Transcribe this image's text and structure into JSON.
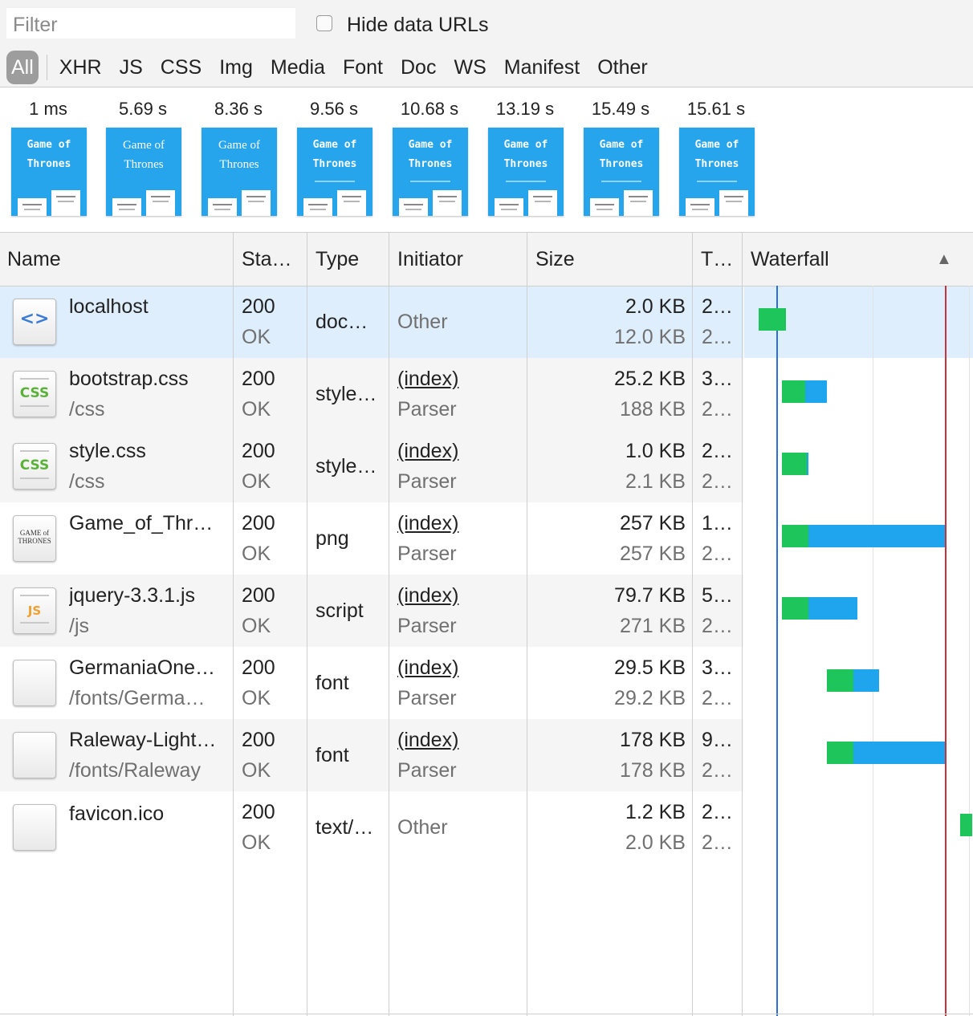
{
  "toolbar": {
    "filter_placeholder": "Filter",
    "hide_data_urls_label": "Hide data URLs",
    "hide_data_urls_checked": false,
    "type_filters": [
      "All",
      "XHR",
      "JS",
      "CSS",
      "Img",
      "Media",
      "Font",
      "Doc",
      "WS",
      "Manifest",
      "Other"
    ],
    "active_filter": "All"
  },
  "filmstrip": {
    "frames": [
      {
        "time": "1 ms",
        "thumb_title": "Game of Thrones"
      },
      {
        "time": "5.69 s",
        "thumb_title": "Game of Thrones"
      },
      {
        "time": "8.36 s",
        "thumb_title": "Game of Thrones"
      },
      {
        "time": "9.56 s",
        "thumb_title": "Game of Thrones"
      },
      {
        "time": "10.68 s",
        "thumb_title": "Game of Thrones"
      },
      {
        "time": "13.19 s",
        "thumb_title": "Game of Thrones"
      },
      {
        "time": "15.49 s",
        "thumb_title": "Game of Thrones"
      },
      {
        "time": "15.61 s",
        "thumb_title": "Game of Thrones"
      }
    ]
  },
  "table": {
    "columns": {
      "name": "Name",
      "status": "Sta…",
      "type": "Type",
      "initiator": "Initiator",
      "size": "Size",
      "time": "T…",
      "waterfall": "Waterfall"
    },
    "sort_indicator": "▲",
    "rows": [
      {
        "name": "localhost",
        "path": "",
        "icon": "html-file-icon",
        "status_code": "200",
        "status_text": "OK",
        "type": "doc…",
        "initiator": "Other",
        "initiator_detail": "",
        "size": "2.0 KB",
        "resource_size": "12.0 KB",
        "time": "2…",
        "latency": "2…"
      },
      {
        "name": "bootstrap.css",
        "path": "/css",
        "icon": "css-file-icon",
        "status_code": "200",
        "status_text": "OK",
        "type": "style…",
        "initiator": "(index)",
        "initiator_detail": "Parser",
        "size": "25.2 KB",
        "resource_size": "188 KB",
        "time": "3…",
        "latency": "2…"
      },
      {
        "name": "style.css",
        "path": "/css",
        "icon": "css-file-icon",
        "status_code": "200",
        "status_text": "OK",
        "type": "style…",
        "initiator": "(index)",
        "initiator_detail": "Parser",
        "size": "1.0 KB",
        "resource_size": "2.1 KB",
        "time": "2…",
        "latency": "2…"
      },
      {
        "name": "Game_of_Thr…",
        "path": "",
        "icon": "image-thumbnail-icon",
        "status_code": "200",
        "status_text": "OK",
        "type": "png",
        "initiator": "(index)",
        "initiator_detail": "Parser",
        "size": "257 KB",
        "resource_size": "257 KB",
        "time": "1…",
        "latency": "2…"
      },
      {
        "name": "jquery-3.3.1.js",
        "path": "/js",
        "icon": "js-file-icon",
        "status_code": "200",
        "status_text": "OK",
        "type": "script",
        "initiator": "(index)",
        "initiator_detail": "Parser",
        "size": "79.7 KB",
        "resource_size": "271 KB",
        "time": "5…",
        "latency": "2…"
      },
      {
        "name": "GermaniaOne…",
        "path": "/fonts/Germa…",
        "icon": "blank-file-icon",
        "status_code": "200",
        "status_text": "OK",
        "type": "font",
        "initiator": "(index)",
        "initiator_detail": "Parser",
        "size": "29.5 KB",
        "resource_size": "29.2 KB",
        "time": "3…",
        "latency": "2…"
      },
      {
        "name": "Raleway-Light…",
        "path": "/fonts/Raleway",
        "icon": "blank-file-icon",
        "status_code": "200",
        "status_text": "OK",
        "type": "font",
        "initiator": "(index)",
        "initiator_detail": "Parser",
        "size": "178 KB",
        "resource_size": "178 KB",
        "time": "9…",
        "latency": "2…"
      },
      {
        "name": "favicon.ico",
        "path": "",
        "icon": "blank-file-icon",
        "status_code": "200",
        "status_text": "OK",
        "type": "text/…",
        "initiator": "Other",
        "initiator_detail": "",
        "size": "1.2 KB",
        "resource_size": "2.0 KB",
        "time": "2…",
        "latency": "2…"
      }
    ]
  },
  "waterfall": {
    "time_range_s": [
      0,
      16.5
    ],
    "dom_content_loaded_s": 2.2,
    "load_event_s": 15.6,
    "colors": {
      "waiting": "#1ec55a",
      "receiving": "#1ea5ee",
      "dom_content_loaded": "#2b6fd6",
      "load": "#c8323a"
    },
    "entries": [
      {
        "start_s": 0.5,
        "waiting_s": 2.0,
        "receiving_s": 0.0
      },
      {
        "start_s": 2.2,
        "waiting_s": 1.8,
        "receiving_s": 1.6
      },
      {
        "start_s": 2.2,
        "waiting_s": 1.9,
        "receiving_s": 0.1
      },
      {
        "start_s": 2.2,
        "waiting_s": 2.0,
        "receiving_s": 10.4
      },
      {
        "start_s": 2.2,
        "waiting_s": 2.0,
        "receiving_s": 3.7
      },
      {
        "start_s": 5.6,
        "waiting_s": 2.0,
        "receiving_s": 1.9
      },
      {
        "start_s": 5.6,
        "waiting_s": 2.0,
        "receiving_s": 7.4
      },
      {
        "start_s": 15.6,
        "waiting_s": 2.0,
        "receiving_s": 0.0
      }
    ]
  }
}
